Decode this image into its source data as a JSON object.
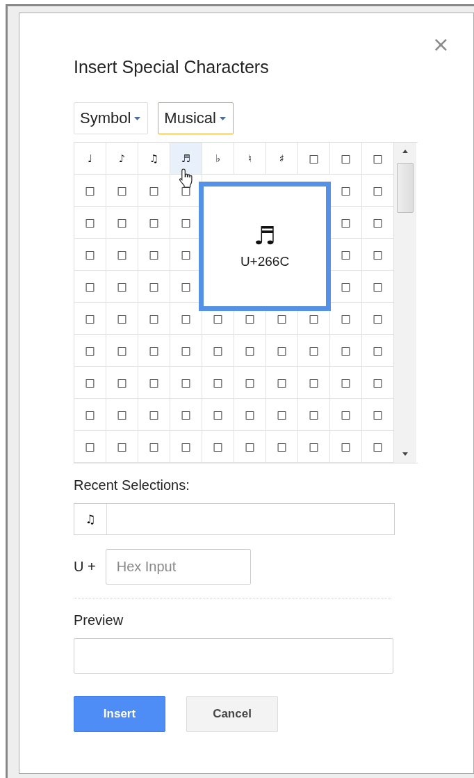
{
  "dialog": {
    "title": "Insert Special Characters",
    "close": "×"
  },
  "dropdowns": [
    {
      "label": "Symbol",
      "focused": false
    },
    {
      "label": "Musical",
      "focused": true
    }
  ],
  "grid": {
    "rows": [
      [
        {
          "char": "♩",
          "hovered": false
        },
        {
          "char": "♪",
          "hovered": false
        },
        {
          "char": "♫",
          "hovered": false
        },
        {
          "char": "♬",
          "hovered": true
        },
        {
          "char": "♭",
          "hovered": false
        },
        {
          "char": "♮",
          "hovered": false
        },
        {
          "char": "♯",
          "hovered": false
        },
        {
          "char": "□",
          "hovered": false
        },
        {
          "char": "□",
          "hovered": false
        },
        {
          "char": "□",
          "hovered": false
        }
      ],
      [
        {
          "char": "□",
          "hovered": false
        },
        {
          "char": "□",
          "hovered": false
        },
        {
          "char": "□",
          "hovered": false
        },
        {
          "char": "□",
          "hovered": false
        },
        {
          "char": "□",
          "hovered": false
        },
        {
          "char": "□",
          "hovered": false
        }
      ],
      [
        {
          "char": "□",
          "hovered": false
        },
        {
          "char": "□",
          "hovered": false
        },
        {
          "char": "□",
          "hovered": false
        },
        {
          "char": "□",
          "hovered": false
        },
        {
          "char": "□",
          "hovered": false
        },
        {
          "char": "□",
          "hovered": false
        }
      ],
      [
        {
          "char": "□",
          "hovered": false
        },
        {
          "char": "□",
          "hovered": false
        },
        {
          "char": "□",
          "hovered": false
        },
        {
          "char": "□",
          "hovered": false
        },
        {
          "char": "□",
          "hovered": false
        },
        {
          "char": "□",
          "hovered": false
        }
      ],
      [
        {
          "char": "□",
          "hovered": false
        },
        {
          "char": "□",
          "hovered": false
        },
        {
          "char": "□",
          "hovered": false
        },
        {
          "char": "□",
          "hovered": false
        },
        {
          "char": "□",
          "hovered": false
        },
        {
          "char": "□",
          "hovered": false
        }
      ],
      [
        {
          "char": "□",
          "hovered": false
        },
        {
          "char": "□",
          "hovered": false
        },
        {
          "char": "□",
          "hovered": false
        },
        {
          "char": "□",
          "hovered": false
        },
        {
          "char": "□",
          "hovered": false
        },
        {
          "char": "□",
          "hovered": false
        },
        {
          "char": "□",
          "hovered": false
        },
        {
          "char": "□",
          "hovered": false
        },
        {
          "char": "□",
          "hovered": false
        },
        {
          "char": "□",
          "hovered": false
        }
      ],
      [
        {
          "char": "□",
          "hovered": false
        },
        {
          "char": "□",
          "hovered": false
        },
        {
          "char": "□",
          "hovered": false
        },
        {
          "char": "□",
          "hovered": false
        },
        {
          "char": "□",
          "hovered": false
        },
        {
          "char": "□",
          "hovered": false
        },
        {
          "char": "□",
          "hovered": false
        },
        {
          "char": "□",
          "hovered": false
        },
        {
          "char": "□",
          "hovered": false
        },
        {
          "char": "□",
          "hovered": false
        }
      ],
      [
        {
          "char": "□",
          "hovered": false
        },
        {
          "char": "□",
          "hovered": false
        },
        {
          "char": "□",
          "hovered": false
        },
        {
          "char": "□",
          "hovered": false
        },
        {
          "char": "□",
          "hovered": false
        },
        {
          "char": "□",
          "hovered": false
        },
        {
          "char": "□",
          "hovered": false
        },
        {
          "char": "□",
          "hovered": false
        },
        {
          "char": "□",
          "hovered": false
        },
        {
          "char": "□",
          "hovered": false
        }
      ],
      [
        {
          "char": "□",
          "hovered": false
        },
        {
          "char": "□",
          "hovered": false
        },
        {
          "char": "□",
          "hovered": false
        },
        {
          "char": "□",
          "hovered": false
        },
        {
          "char": "□",
          "hovered": false
        },
        {
          "char": "□",
          "hovered": false
        },
        {
          "char": "□",
          "hovered": false
        },
        {
          "char": "□",
          "hovered": false
        },
        {
          "char": "□",
          "hovered": false
        },
        {
          "char": "□",
          "hovered": false
        }
      ],
      [
        {
          "char": "□",
          "hovered": false
        },
        {
          "char": "□",
          "hovered": false
        },
        {
          "char": "□",
          "hovered": false
        },
        {
          "char": "□",
          "hovered": false
        },
        {
          "char": "□",
          "hovered": false
        },
        {
          "char": "□",
          "hovered": false
        },
        {
          "char": "□",
          "hovered": false
        },
        {
          "char": "□",
          "hovered": false
        },
        {
          "char": "□",
          "hovered": false
        },
        {
          "char": "□",
          "hovered": false
        }
      ]
    ],
    "preview": {
      "char": "♬",
      "code": "U+266C"
    }
  },
  "recent": {
    "label": "Recent Selections:",
    "items": [
      "♫"
    ]
  },
  "hex": {
    "prefix": "U +",
    "placeholder": "Hex Input"
  },
  "preview": {
    "label": "Preview"
  },
  "buttons": [
    {
      "label": "Insert",
      "kind": "primary"
    },
    {
      "label": "Cancel",
      "kind": "secondary"
    }
  ]
}
